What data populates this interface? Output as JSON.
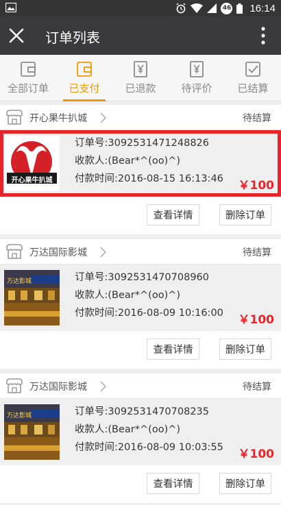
{
  "statusbar": {
    "time": "16:14",
    "badge": "46"
  },
  "titlebar": {
    "title": "订单列表"
  },
  "tabs": [
    {
      "label": "全部订单",
      "icon": "wallet-icon",
      "active": false
    },
    {
      "label": "已支付",
      "icon": "wallet-icon",
      "active": true
    },
    {
      "label": "已退款",
      "icon": "yen-refund-icon",
      "active": false
    },
    {
      "label": "待评价",
      "icon": "yen-review-icon",
      "active": false
    },
    {
      "label": "已结算",
      "icon": "checkbox-icon",
      "active": false
    }
  ],
  "orders": [
    {
      "shop": "开心果牛扒城",
      "status": "待结算",
      "order_no_label": "订单号:",
      "order_no": "3092531471248826",
      "payee_label": "收款人:",
      "payee": "(Bear*^(oo)^)",
      "time_label": "付款时间:",
      "time": "2016-08-15 16:13:46",
      "price": "￥100",
      "thumb_text": "开心果牛扒城",
      "detail_label": "查看详情",
      "delete_label": "删除订单"
    },
    {
      "shop": "万达国际影城",
      "status": "待结算",
      "order_no_label": "订单号:",
      "order_no": "3092531470708960",
      "payee_label": "收款人:",
      "payee": "(Bear*^(oo)^)",
      "time_label": "付款时间:",
      "time": "2016-08-09 10:16:00",
      "price": "￥100",
      "thumb_text": "万达影城",
      "detail_label": "查看详情",
      "delete_label": "删除订单"
    },
    {
      "shop": "万达国际影城",
      "status": "待结算",
      "order_no_label": "订单号:",
      "order_no": "3092531470708235",
      "payee_label": "收款人:",
      "payee": "(Bear*^(oo)^)",
      "time_label": "付款时间:",
      "time": "2016-08-09 10:03:55",
      "price": "￥100",
      "thumb_text": "万达影城",
      "detail_label": "查看详情",
      "delete_label": "删除订单"
    }
  ],
  "colors": {
    "accent": "#f39800",
    "price": "#e6252b",
    "titlebar": "#393a3e"
  }
}
